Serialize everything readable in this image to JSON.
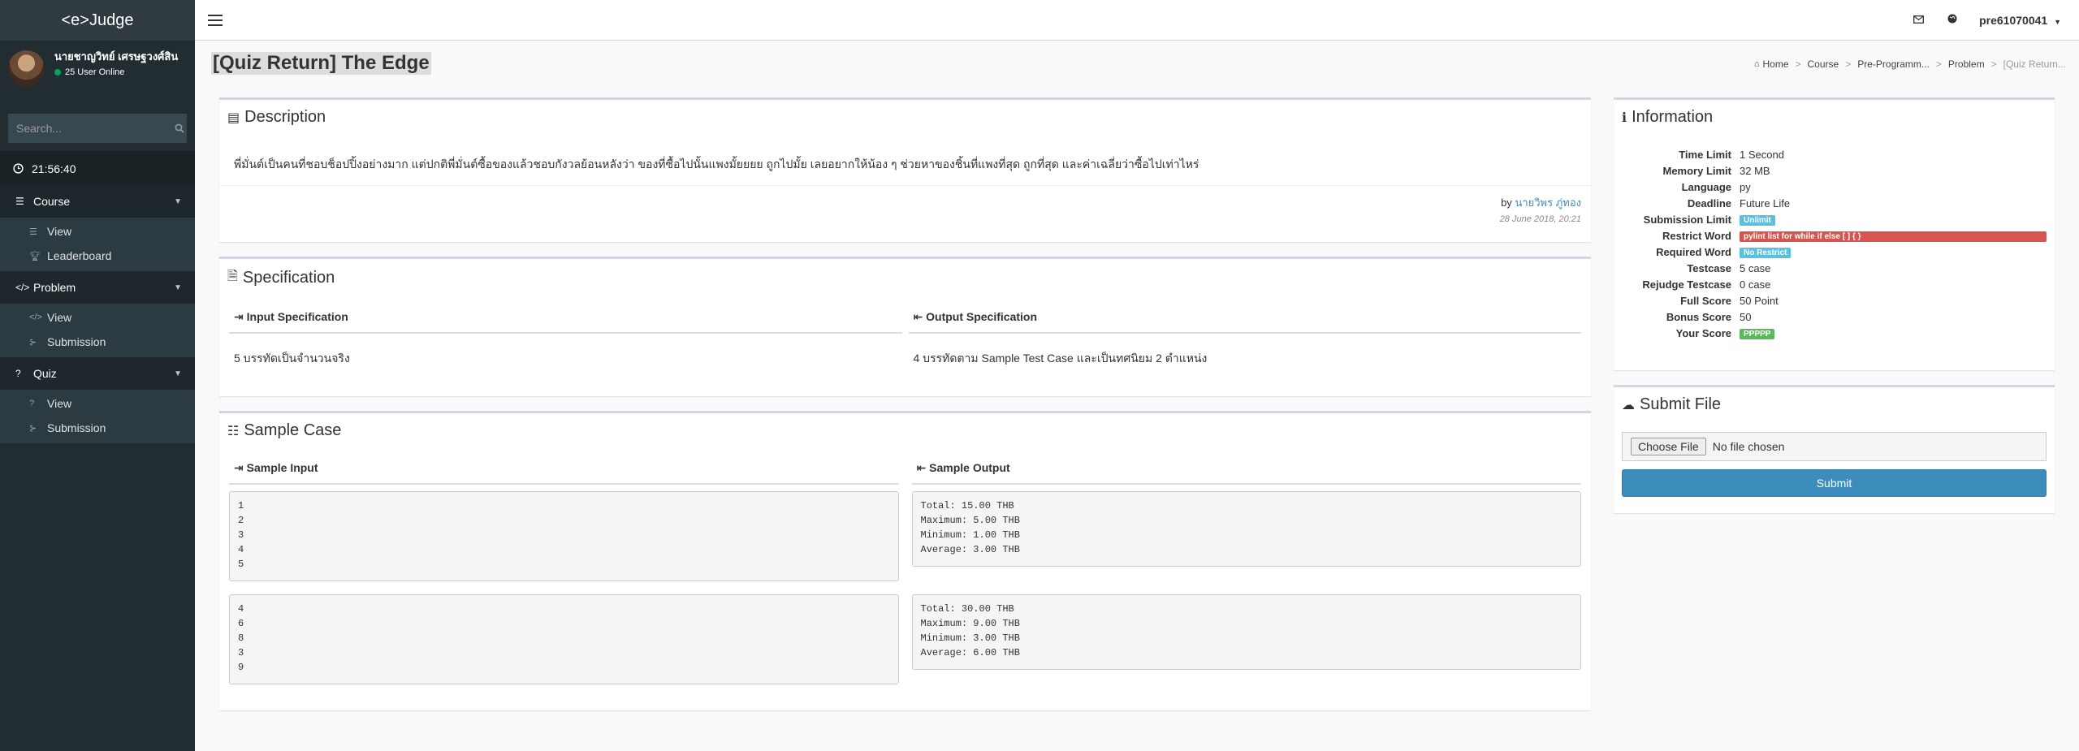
{
  "brand": "<e>Judge",
  "user": {
    "name": "นายชาญวิทย์ เศรษฐวงศ์สิน",
    "online": "25 User Online"
  },
  "search": {
    "placeholder": "Search..."
  },
  "clock": "21:56:40",
  "menu": {
    "course": {
      "label": "Course",
      "items": [
        "View",
        "Leaderboard"
      ]
    },
    "problem": {
      "label": "Problem",
      "items": [
        "View",
        "Submission"
      ]
    },
    "quiz": {
      "label": "Quiz",
      "items": [
        "View",
        "Submission"
      ]
    }
  },
  "topbar": {
    "username": "pre61070041"
  },
  "page": {
    "title": "[Quiz Return] The Edge"
  },
  "breadcrumb": [
    "Home",
    "Course",
    "Pre-Programm...",
    "Problem",
    "[Quiz Return..."
  ],
  "description": {
    "title": "Description",
    "text": "พี่มั่นต์เป็นคนที่ชอบช็อปปิ้งอย่างมาก แต่ปกติพี่มั่นต์ซื้อของแล้วชอบกังวลย้อนหลังว่า ของที่ซื้อไปนั้นแพงมั้ยยยย ถูกไปมั้ย เลยอยากให้น้อง ๆ ช่วยหาของชิ้นที่แพงที่สุด ถูกที่สุด และค่าเฉลี่ยว่าซื้อไปเท่าไหร่",
    "by_label": "by",
    "author": "นายวิพร ภู่ทอง",
    "date": "28 June 2018, 20:21"
  },
  "specification": {
    "title": "Specification",
    "input_label": "Input Specification",
    "input_text": "5 บรรทัดเป็นจำนวนจริง",
    "output_label": "Output Specification",
    "output_text": "4 บรรทัดตาม Sample Test Case และเป็นทศนิยม 2 ตำแหน่ง"
  },
  "sample": {
    "title": "Sample Case",
    "input_label": "Sample Input",
    "output_label": "Sample Output",
    "cases": [
      {
        "input": "1\n2\n3\n4\n5",
        "output": "Total: 15.00 THB\nMaximum: 5.00 THB\nMinimum: 1.00 THB\nAverage: 3.00 THB"
      },
      {
        "input": "4\n6\n8\n3\n9",
        "output": "Total: 30.00 THB\nMaximum: 9.00 THB\nMinimum: 3.00 THB\nAverage: 6.00 THB"
      }
    ]
  },
  "information": {
    "title": "Information",
    "rows": [
      {
        "key": "Time Limit",
        "value": "1 Second"
      },
      {
        "key": "Memory Limit",
        "value": "32 MB"
      },
      {
        "key": "Language",
        "value": "py"
      },
      {
        "key": "Deadline",
        "value": "Future Life"
      },
      {
        "key": "Submission Limit",
        "badge": "Unlimit"
      },
      {
        "key": "Restrict Word",
        "badge": "pylint list for while if else [ ] { }"
      },
      {
        "key": "Required Word",
        "badge": "No Restrict"
      },
      {
        "key": "Testcase",
        "value": "5 case"
      },
      {
        "key": "Rejudge Testcase",
        "value": "0 case"
      },
      {
        "key": "Full Score",
        "value": "50 Point"
      },
      {
        "key": "Bonus Score",
        "value": "50"
      },
      {
        "key": "Your Score",
        "badge": "PPPPP"
      }
    ]
  },
  "submit": {
    "title": "Submit File",
    "choose_label": "Choose File",
    "no_file": "No file chosen",
    "button": "Submit"
  },
  "colors": {
    "info": "#5bc0de",
    "danger": "#d9534f",
    "success": "#5cb85c",
    "primary": "#3c8dbc"
  },
  "icons": [
    "bars-icon",
    "search-icon",
    "clock-icon",
    "list-icon",
    "trophy-icon",
    "code-icon",
    "history-icon",
    "question-icon",
    "envelope-icon",
    "globe-icon",
    "info-icon",
    "file-icon",
    "sign-in-icon",
    "sign-out-icon",
    "cloud-upload-icon"
  ]
}
